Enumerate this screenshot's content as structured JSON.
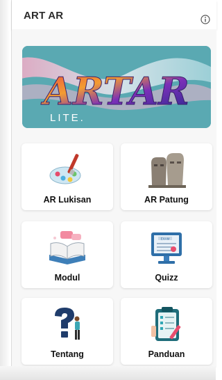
{
  "app": {
    "title": "ART AR"
  },
  "header": {
    "info_icon": "info-icon"
  },
  "banner": {
    "logo_text": "ARTAR",
    "subtitle": "LITE."
  },
  "menu": {
    "items": [
      {
        "label": "AR Lukisan",
        "icon": "palette-icon"
      },
      {
        "label": "AR Patung",
        "icon": "statue-icon"
      },
      {
        "label": "Modul",
        "icon": "book-icon"
      },
      {
        "label": "Quizz",
        "icon": "exam-icon"
      },
      {
        "label": "Tentang",
        "icon": "question-icon"
      },
      {
        "label": "Panduan",
        "icon": "clipboard-icon"
      }
    ]
  },
  "colors": {
    "banner_bg": "#58a9b3",
    "card_bg": "#ffffff",
    "text": "#111111"
  }
}
